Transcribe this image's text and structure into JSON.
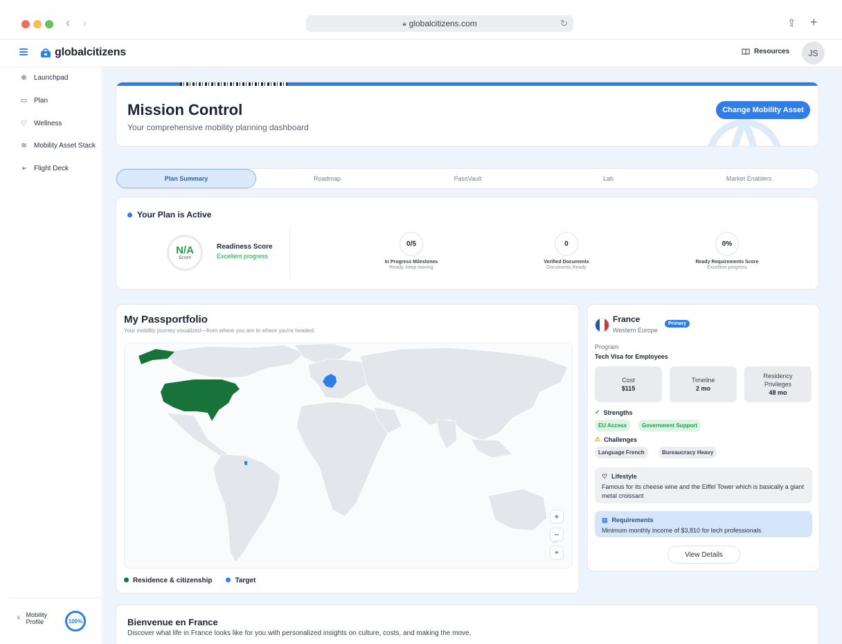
{
  "browser": {
    "url": "globalcitizens.com"
  },
  "header": {
    "brand": "globalcitizens",
    "resources_label": "Resources",
    "avatar_initials": "JS"
  },
  "sidebar": {
    "items": [
      {
        "label": "Launchpad",
        "icon": "globe-icon"
      },
      {
        "label": "Plan",
        "icon": "calendar-icon"
      },
      {
        "label": "Wellness",
        "icon": "heart-icon"
      },
      {
        "label": "Mobility Asset Stack",
        "icon": "layers-icon"
      },
      {
        "label": "Flight Deck",
        "icon": "send-icon"
      }
    ],
    "profile": {
      "label_line1": "Mobility",
      "label_line2": "Profile",
      "progress": "100%"
    }
  },
  "mission": {
    "title": "Mission Control",
    "subtitle": "Your comprehensive mobility planning dashboard",
    "cta": "Change Mobility Asset"
  },
  "tabs": [
    "Plan Summary",
    "Roadmap",
    "PassVault",
    "Lab",
    "Market Enablers"
  ],
  "plan": {
    "title": "Your Plan is Active",
    "score_value": "N/A",
    "score_label": "Score",
    "readiness_title": "Readiness Score",
    "readiness_sub": "Excellent progress",
    "metrics": [
      {
        "value": "0/5",
        "label": "In Progress Milestones",
        "sub": "Ready, keep moving"
      },
      {
        "value": "0",
        "label": "Verified Documents",
        "sub": "Documents Ready"
      },
      {
        "value": "0%",
        "label": "Ready Requirements Score",
        "sub": "Excellent progress"
      }
    ]
  },
  "passportfolio": {
    "title": "My Passportfolio",
    "subtitle": "Your mobility journey visualized—from where you are to where you're headed.",
    "legend": [
      {
        "label": "Residence & citizenship",
        "color": "#17733a"
      },
      {
        "label": "Target",
        "color": "#2f7ee8"
      }
    ],
    "controls": {
      "zoom_in": "+",
      "zoom_out": "−",
      "reset": "⌖"
    }
  },
  "country": {
    "name": "France",
    "region": "Western Europe",
    "badge": "Primary",
    "program_label": "Program",
    "program": "Tech Visa for Employees",
    "stats": [
      {
        "label": "Cost",
        "value": "$115"
      },
      {
        "label": "Timeline",
        "value": "2 mo"
      },
      {
        "label": "Residency Privileges",
        "value": "48 mo"
      }
    ],
    "strengths_title": "Strengths",
    "strengths": [
      "EU Access",
      "Government Support"
    ],
    "challenges_title": "Challenges",
    "challenges": [
      "Language French",
      "Bureaucracy Heavy"
    ],
    "lifestyle_title": "Lifestyle",
    "lifestyle": "Famous for its cheese wine and the Eiffel Tower which is basically a giant metal croissant",
    "requirements_title": "Requirements",
    "requirements": "Minimum monthly income of $3,810 for tech professionals",
    "view_details": "View Details"
  },
  "welcome": {
    "title": "Bienvenue en France",
    "subtitle": "Discover what life in France looks like for you with personalized insights on culture, costs, and making the move."
  },
  "colors": {
    "accent": "#2f7ee8",
    "residence": "#17733a",
    "success": "#1e9e4a"
  }
}
